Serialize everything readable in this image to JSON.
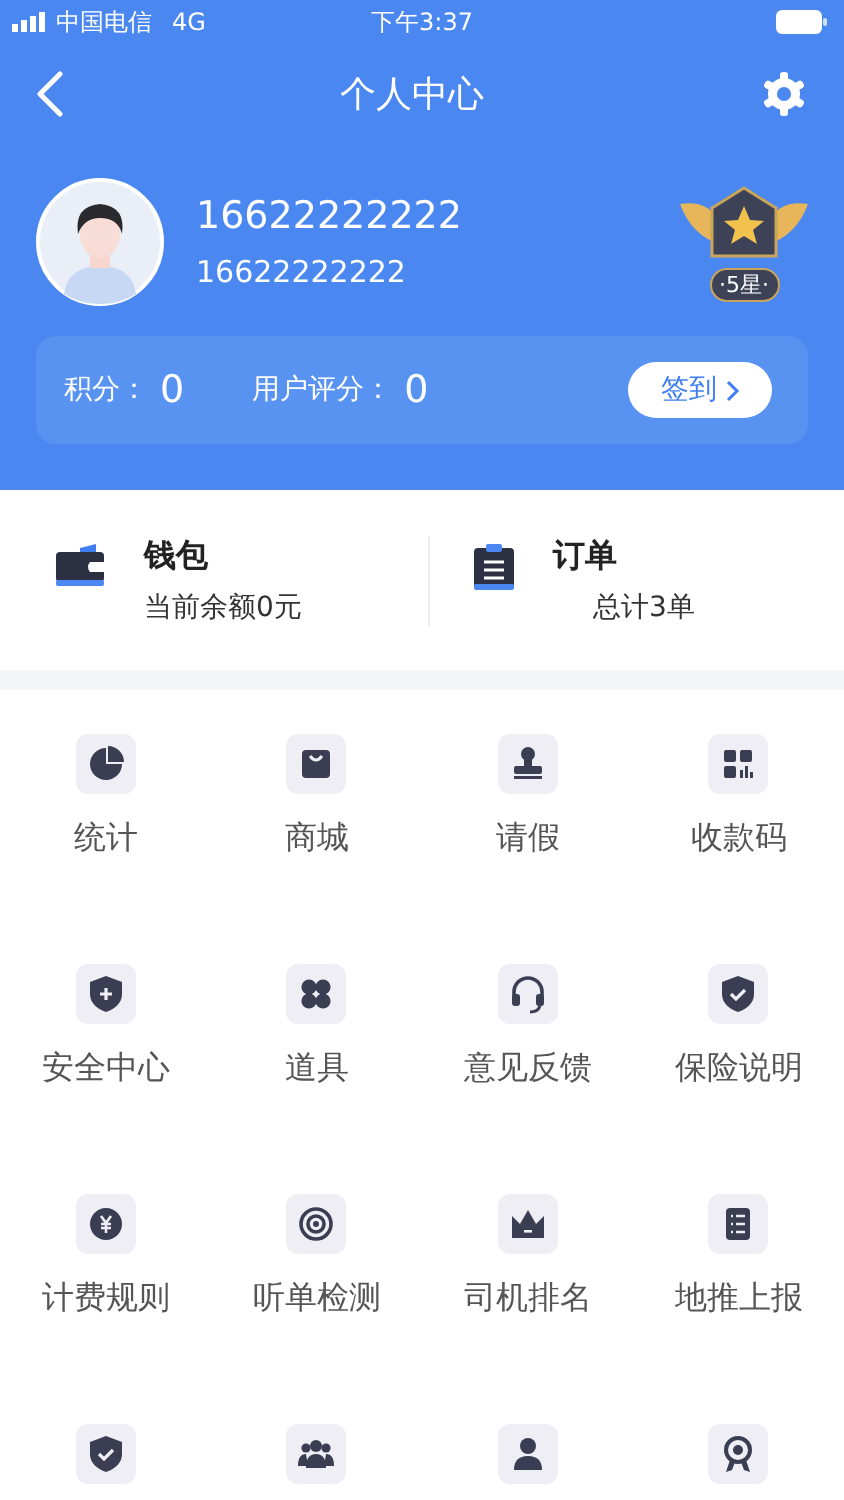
{
  "status_bar": {
    "carrier": "中国电信",
    "network": "4G",
    "time": "下午3:37"
  },
  "nav": {
    "title": "个人中心"
  },
  "profile": {
    "name": "16622222222",
    "phone": "16622222222",
    "badge": "·5星·"
  },
  "stats": {
    "items": [
      {
        "label": "积分：",
        "value": "0"
      },
      {
        "label": "用户评分：",
        "value": "0"
      }
    ],
    "button": "签到"
  },
  "summary": [
    {
      "title": "钱包",
      "subtitle": "当前余额0元"
    },
    {
      "title": "订单",
      "subtitle": "总计3单"
    }
  ],
  "grid": [
    {
      "kind": "labeled",
      "label": "统计"
    },
    {
      "kind": "labeled",
      "label": "商城"
    },
    {
      "kind": "labeled",
      "label": "请假"
    },
    {
      "kind": "labeled",
      "label": "收款码"
    },
    {
      "kind": "labeled",
      "label": "安全中心"
    },
    {
      "kind": "labeled",
      "label": "道具"
    },
    {
      "kind": "labeled",
      "label": "意见反馈"
    },
    {
      "kind": "labeled",
      "label": "保险说明"
    },
    {
      "kind": "labeled",
      "label": "计费规则"
    },
    {
      "kind": "labeled",
      "label": "听单检测"
    },
    {
      "kind": "labeled",
      "label": "司机排名"
    },
    {
      "kind": "labeled",
      "label": "地推上报"
    },
    {
      "kind": "icon"
    },
    {
      "kind": "icon"
    },
    {
      "kind": "icon"
    },
    {
      "kind": "icon"
    }
  ]
}
